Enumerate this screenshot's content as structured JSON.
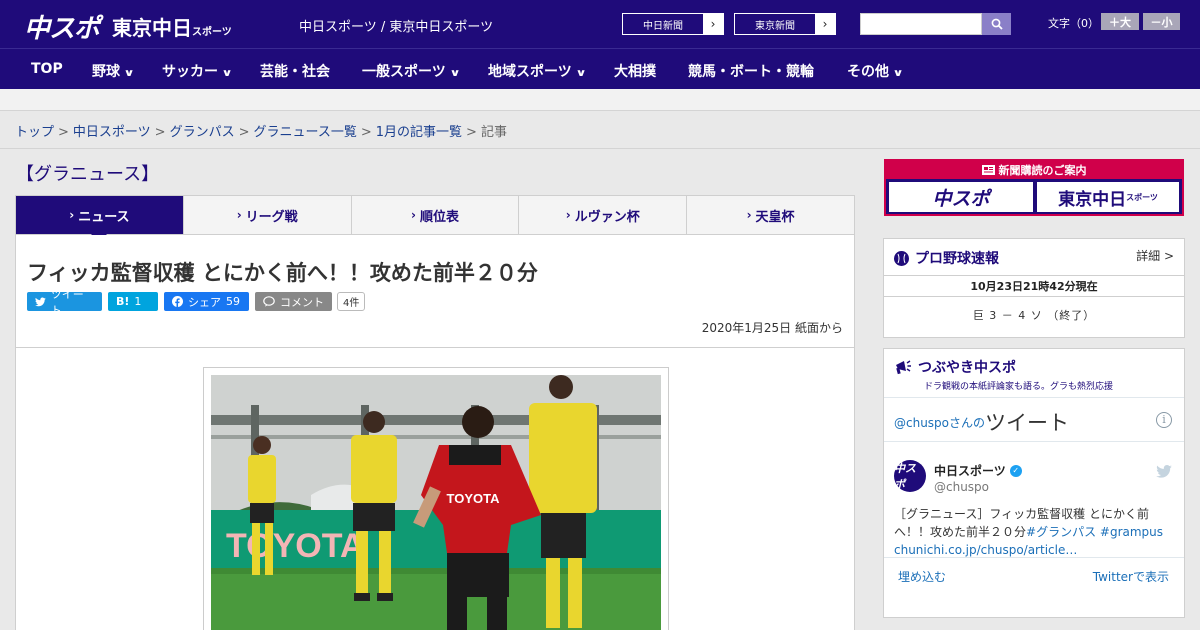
{
  "header": {
    "logo_chuspo": "中スポ",
    "logo_tokyo": "東京中日",
    "logo_tokyo_small": "スポーツ",
    "site_names": "中日スポーツ / 東京中日スポーツ",
    "pub_links": [
      "中日新聞",
      "東京新聞"
    ],
    "search_placeholder": "",
    "font_size_label": "文字（0）",
    "font_bigger": "＋大",
    "font_smaller": "－小"
  },
  "nav": {
    "items": [
      {
        "label": "TOP",
        "dropdown": false
      },
      {
        "label": "野球",
        "dropdown": true
      },
      {
        "label": "サッカー",
        "dropdown": true
      },
      {
        "label": "芸能・社会",
        "dropdown": false
      },
      {
        "label": "一般スポーツ",
        "dropdown": true
      },
      {
        "label": "地域スポーツ",
        "dropdown": true
      },
      {
        "label": "大相撲",
        "dropdown": false
      },
      {
        "label": "競馬・ボート・競輪",
        "dropdown": false
      },
      {
        "label": "その他",
        "dropdown": true
      }
    ]
  },
  "breadcrumb": {
    "items": [
      "トップ",
      "中日スポーツ",
      "グランパス",
      "グラニュース一覧",
      "1月の記事一覧"
    ],
    "current": "記事",
    "separator": ">"
  },
  "main": {
    "section_title": "【グラニュース】",
    "tabs": [
      {
        "label": "ニュース",
        "active": true
      },
      {
        "label": "リーグ戦",
        "active": false
      },
      {
        "label": "順位表",
        "active": false
      },
      {
        "label": "ルヴァン杯",
        "active": false
      },
      {
        "label": "天皇杯",
        "active": false
      }
    ],
    "headline": "フィッカ監督収穫 とにかく前へ！！攻めた前半２０分",
    "share": {
      "tweet_label": "ツイート",
      "hatena_label": "B!",
      "hatena_count": "1",
      "facebook_label": "シェア",
      "facebook_count": "59",
      "comment_label": "コメント",
      "comment_count": "4件"
    },
    "dateline": "2020年1月25日 紙面から"
  },
  "sidebar": {
    "subscribe": {
      "title": "新聞購読のご案内",
      "logo_a": "中スポ",
      "logo_b": "東京中日",
      "logo_b_small": "スポーツ"
    },
    "baseball": {
      "title": "プロ野球速報",
      "detail": "詳細 >",
      "time": "10月23日21時42分現在",
      "score": "巨 3 － 4 ソ （終了）"
    },
    "twitter": {
      "title": "つぶやき中スポ",
      "subtitle": "ドラ観戦の本紙評論家も語る。グラも熱烈応援",
      "head_handle": "@chuspo",
      "head_mid": "さんの",
      "head_big": "ツイート",
      "avatar_text": "中スポ",
      "name": "中日スポーツ",
      "handle": "@chuspo",
      "text": "［グラニュース］フィッカ監督収穫 とにかく前へ！！攻めた前半２０分",
      "tag1": "#グランパス",
      "tag2": "#grampus",
      "link": "chunichi.co.jp/chuspo/article…",
      "embed": "埋め込む",
      "view_on": "Twitterで表示"
    }
  },
  "colors": {
    "brand_navy": "#1f0b7a",
    "accent_red": "#d0004a",
    "twitter_blue": "#1b95e0",
    "facebook_blue": "#1877f2",
    "hatena_blue": "#00a4de"
  }
}
